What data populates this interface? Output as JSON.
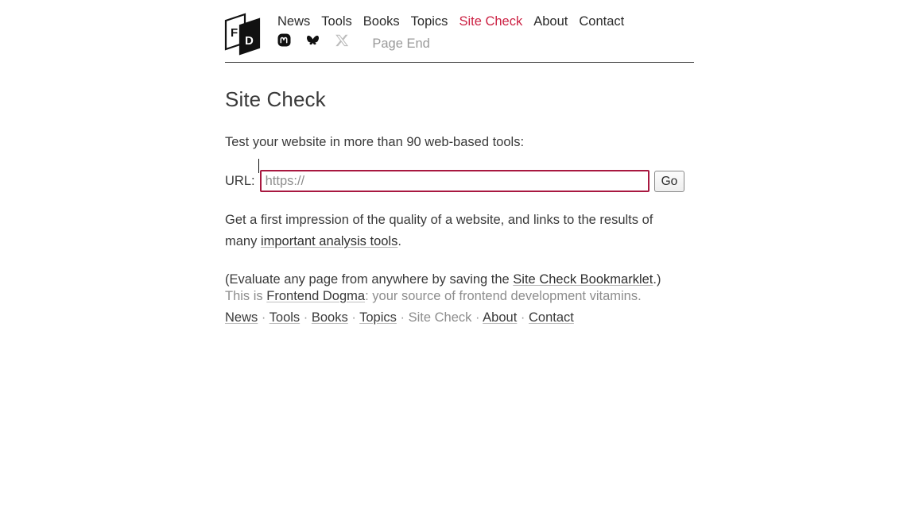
{
  "header": {
    "logo_alt": "Frontend Dogma logo",
    "logo_letters": [
      "F",
      "D"
    ],
    "nav": [
      {
        "label": "News",
        "current": false
      },
      {
        "label": "Tools",
        "current": false
      },
      {
        "label": "Books",
        "current": false
      },
      {
        "label": "Topics",
        "current": false
      },
      {
        "label": "Site Check",
        "current": true
      },
      {
        "label": "About",
        "current": false
      },
      {
        "label": "Contact",
        "current": false
      }
    ],
    "social": [
      {
        "icon": "mastodon-icon",
        "name": "Mastodon"
      },
      {
        "icon": "bluesky-icon",
        "name": "Bluesky"
      },
      {
        "icon": "x-icon",
        "name": "X"
      }
    ],
    "page_end_label": "Page End"
  },
  "main": {
    "title": "Site Check",
    "intro": "Test your website in more than 90 web-based tools:",
    "form": {
      "url_label": "URL:",
      "url_value": "",
      "url_placeholder": "https://",
      "submit_label": "Go"
    },
    "description_part1": "Get a first impression of the quality of a website, and links to the results of many ",
    "description_link": "important analysis tools",
    "description_part2": ".",
    "bookmarklet_part1": "(Evaluate any page from anywhere by saving the ",
    "bookmarklet_link": "Site Check Bookmarklet",
    "bookmarklet_part2": ".)"
  },
  "footer": {
    "tagline_prefix": "This is ",
    "tagline_link": "Frontend Dogma",
    "tagline_suffix": ": your source of frontend development vitamins.",
    "links": [
      {
        "label": "News",
        "current": false
      },
      {
        "label": "Tools",
        "current": false
      },
      {
        "label": "Books",
        "current": false
      },
      {
        "label": "Topics",
        "current": false
      },
      {
        "label": "Site Check",
        "current": true
      },
      {
        "label": "About",
        "current": false
      },
      {
        "label": "Contact",
        "current": false
      }
    ],
    "separator": "·"
  },
  "colors": {
    "accent": "#cc2244",
    "focus_border": "#a81840",
    "text": "#3a3a3a",
    "muted": "#8d8d8d",
    "rule": "#3a3a3a"
  }
}
